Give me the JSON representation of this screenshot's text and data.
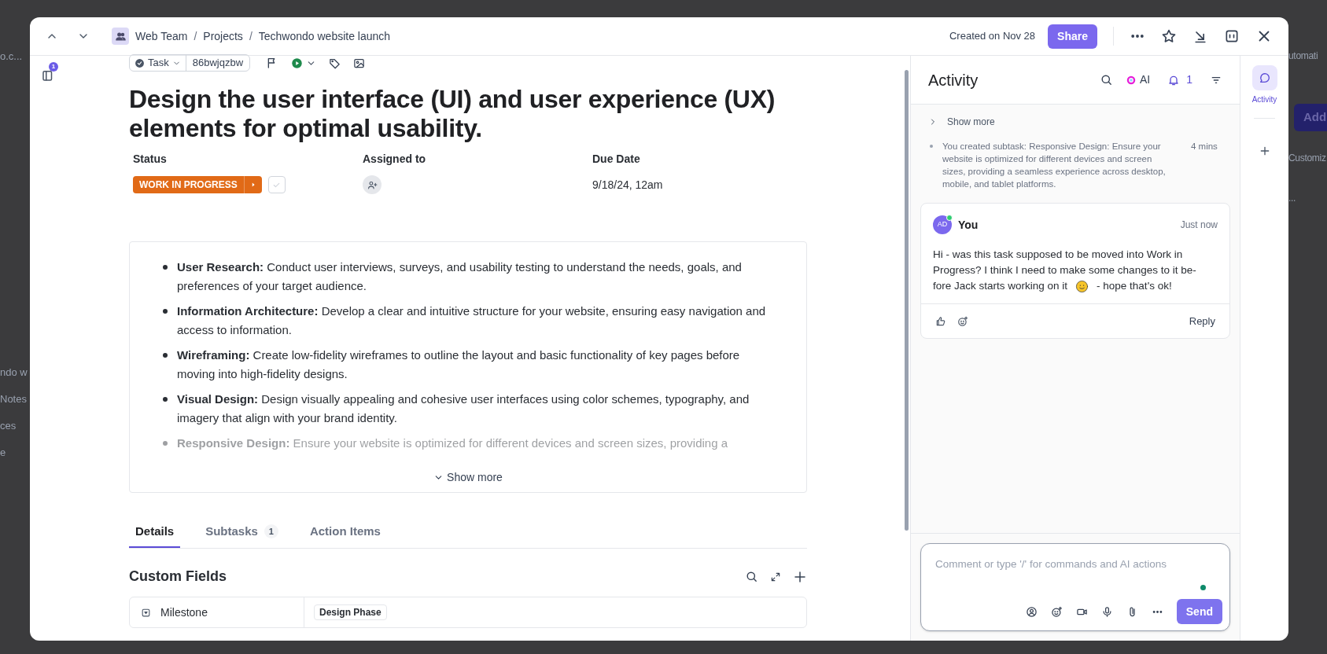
{
  "backdrop": {
    "left_texts": [
      "o.c...",
      "ndo w",
      "Notes",
      "ces",
      "e"
    ],
    "right_texts": [
      "utomati",
      "Add",
      "Customiz",
      "..."
    ]
  },
  "header": {
    "breadcrumbs": [
      "Web Team",
      "Projects",
      "Techwondo website launch"
    ],
    "separators": [
      "/",
      "/"
    ],
    "created": "Created on Nov 28",
    "share": "Share"
  },
  "left_rail": {
    "badge": "1"
  },
  "task": {
    "type": "Task",
    "id": "86bwjqzbw",
    "title": "Design the user interface (UI) and user experience (UX) elements for optimal usability.",
    "fields": [
      {
        "label": "Status",
        "kind": "status",
        "value": "WORK IN PROGRESS",
        "color": "#e16a17",
        "completed": false
      },
      {
        "label": "Assigned to",
        "kind": "assignee"
      },
      {
        "label": "Due Date",
        "kind": "date",
        "value": "9/18/24, 12am"
      }
    ]
  },
  "description": {
    "items": [
      {
        "text": "**User Research:** Conduct user interviews, surveys, and usability testing to understand the needs, goals, and preferences of your target audience.",
        "faded": false
      },
      {
        "text": "**Information Architecture:** Develop a clear and intuitive structure for your website, ensuring easy navigation and access to information.",
        "faded": false
      },
      {
        "text": "**Wireframing:** Create low-fidelity wireframes to outline the layout and basic functionality of key pages before moving into high-fidelity designs.",
        "faded": false
      },
      {
        "text": "**Visual Design:** Design visually appealing and cohesive user interfaces using color schemes, typography, and imagery that align with your brand identity.",
        "faded": false
      },
      {
        "text": "**Responsive Design:** Ensure your website is optimized for different devices and screen sizes, providing a",
        "faded": true
      }
    ],
    "show_more": "Show more"
  },
  "tabs": [
    {
      "label": "Details",
      "selected": true
    },
    {
      "label": "Subtasks",
      "count": "1",
      "selected": false
    },
    {
      "label": "Action Items",
      "selected": false
    }
  ],
  "custom_fields": {
    "title": "Custom Fields",
    "rows": [
      {
        "name": "Milestone",
        "value": "Design Phase"
      }
    ]
  },
  "activity": {
    "title": "Activity",
    "ai": "AI",
    "notifications": "1",
    "show_more": "Show more",
    "events": [
      {
        "text": "You created subtask: Responsive Design: Ensure your website is optimized for different devices and screen sizes, providing a seamless experience across desktop, mobile, and tablet platforms.",
        "time": "4 mins"
      }
    ],
    "comments": [
      {
        "initials": "AD",
        "online": true,
        "author": "You",
        "time": "Just now",
        "text": "Hi - was this task supposed to be moved into Work in Progress? I think I need to make some changes to it be-",
        "text_continued": "fore Jack starts working on it",
        "text_after_emoji": "- hope that's ok!",
        "reply": "Reply"
      }
    ],
    "composer": {
      "placeholder": "Comment or type '/' for commands and AI actions",
      "send": "Send"
    }
  },
  "side_rail": {
    "tabs": [
      {
        "label": "Activity",
        "selected": true
      }
    ]
  }
}
